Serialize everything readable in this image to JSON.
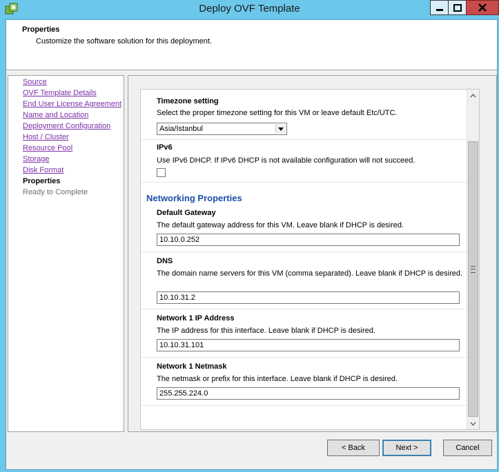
{
  "window": {
    "title": "Deploy OVF Template",
    "icon": "vsphere-app-icon",
    "controls": [
      "minimize",
      "maximize",
      "close"
    ]
  },
  "header": {
    "title": "Properties",
    "subtitle": "Customize the software solution for this deployment."
  },
  "nav": {
    "items": [
      {
        "label": "Source",
        "state": "link"
      },
      {
        "label": "OVF Template Details",
        "state": "link"
      },
      {
        "label": "End User License Agreement",
        "state": "link"
      },
      {
        "label": "Name and Location",
        "state": "link"
      },
      {
        "label": "Deployment Configuration",
        "state": "link"
      },
      {
        "label": "Host / Cluster",
        "state": "link"
      },
      {
        "label": "Resource Pool",
        "state": "link"
      },
      {
        "label": "Storage",
        "state": "link"
      },
      {
        "label": "Disk Format",
        "state": "link"
      },
      {
        "label": "Properties",
        "state": "current"
      },
      {
        "label": "Ready to Complete",
        "state": "future"
      }
    ]
  },
  "properties": {
    "timezone": {
      "label": "Timezone setting",
      "description": "Select the proper timezone setting for this VM or leave default Etc/UTC.",
      "value": "Asia/Istanbul"
    },
    "ipv6": {
      "label": "IPv6",
      "description": "Use IPv6 DHCP. If IPv6 DHCP is not available configuration will not succeed.",
      "checked": false
    },
    "networking_title": "Networking Properties",
    "gateway": {
      "label": "Default Gateway",
      "description": "The default gateway address for this VM. Leave blank if DHCP is desired.",
      "value": "10.10.0.252"
    },
    "dns": {
      "label": "DNS",
      "description": "The domain name servers for this VM (comma separated). Leave blank if DHCP is desired.",
      "value": "10.10.31.2"
    },
    "ip": {
      "label": "Network 1 IP Address",
      "description": "The IP address for this interface. Leave blank if DHCP is desired.",
      "value": "10.10.31.101"
    },
    "netmask": {
      "label": "Network 1 Netmask",
      "description": "The netmask or prefix for this interface. Leave blank if DHCP is desired.",
      "value": "255.255.224.0"
    }
  },
  "buttons": {
    "back": "< Back",
    "next": "Next >",
    "cancel": "Cancel"
  },
  "colors": {
    "titlebar": "#6cc8eb",
    "link": "#7b2fa8",
    "section_title": "#1b4fa8",
    "close_button": "#c74b4b"
  }
}
